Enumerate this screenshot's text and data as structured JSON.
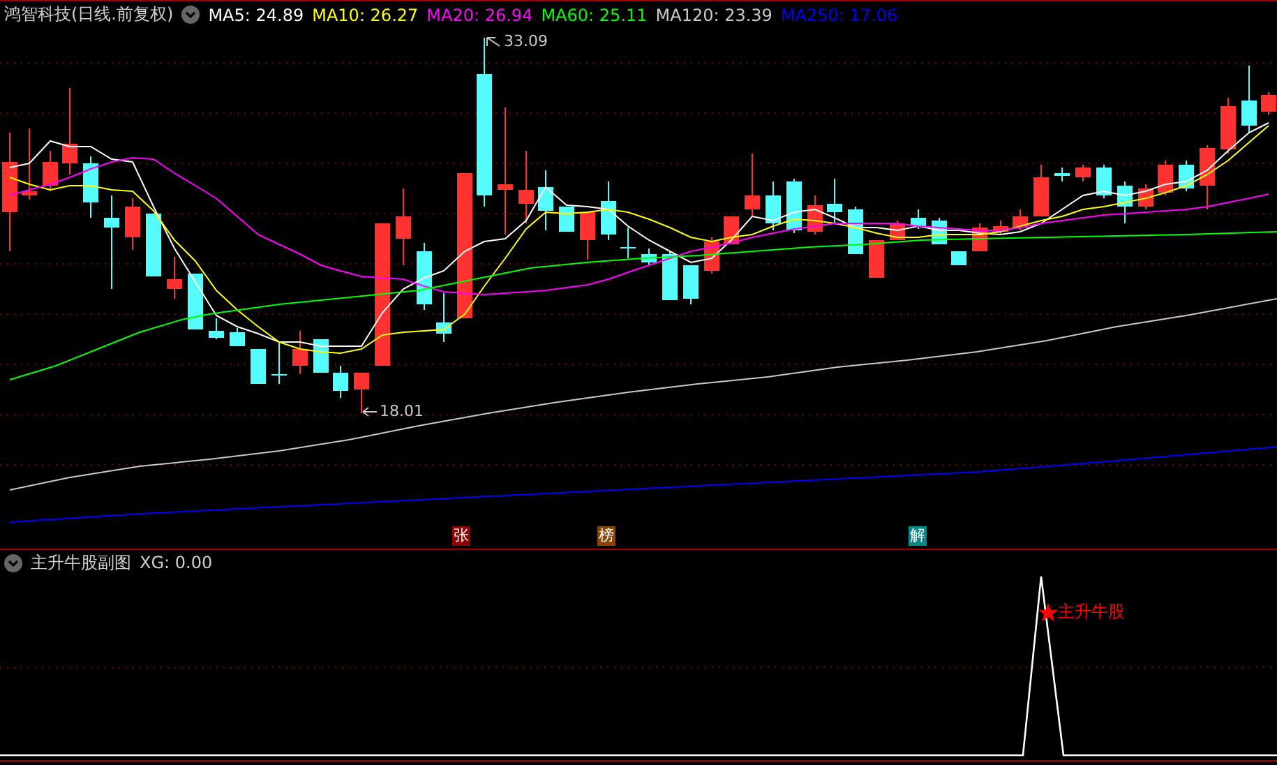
{
  "main_panel": {
    "title": "鸿智科技(日线.前复权)",
    "legend": [
      {
        "label": "MA5: 24.89",
        "color": "#ffffff"
      },
      {
        "label": "MA10: 26.27",
        "color": "#ffff00"
      },
      {
        "label": "MA20: 26.94",
        "color": "#ff00ff"
      },
      {
        "label": "MA60: 25.11",
        "color": "#00ff00"
      },
      {
        "label": "MA120: 23.39",
        "color": "#c8c8c8"
      },
      {
        "label": "MA250: 17.06",
        "color": "#0000ff"
      }
    ],
    "high_label": "33.09",
    "low_label": "18.01",
    "markers": [
      {
        "label": "张",
        "color": "#8b0000"
      },
      {
        "label": "榜",
        "color": "#8b4500"
      },
      {
        "label": "解",
        "color": "#008b8b"
      }
    ]
  },
  "sub_panel": {
    "title": "主升牛股副图",
    "reading": "XG: 0.00",
    "signal_label": "主升牛股"
  }
}
